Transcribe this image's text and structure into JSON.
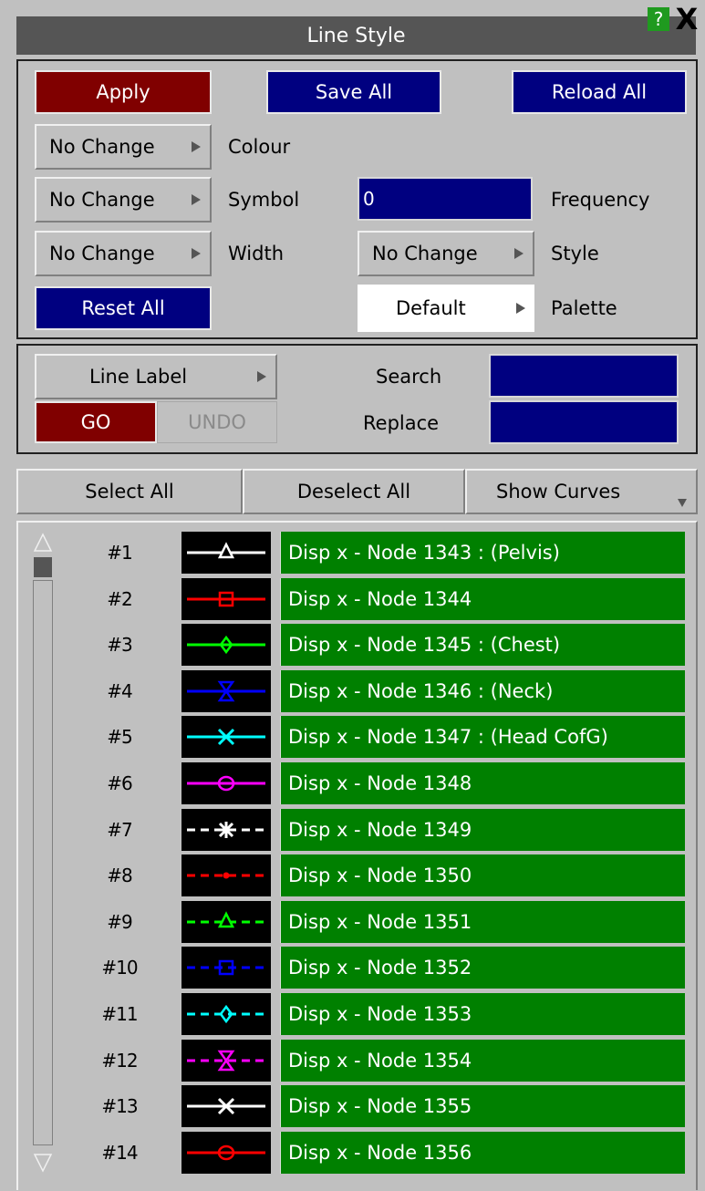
{
  "window": {
    "title": "Line Style",
    "help_label": "?",
    "close_label": "X"
  },
  "toolbar": {
    "apply_label": "Apply",
    "save_all_label": "Save All",
    "reload_all_label": "Reload All",
    "reset_all_label": "Reset All"
  },
  "properties": {
    "colour": {
      "value": "No Change",
      "label": "Colour"
    },
    "symbol": {
      "value": "No Change",
      "label": "Symbol"
    },
    "frequency": {
      "value": "0",
      "label": "Frequency"
    },
    "width": {
      "value": "No Change",
      "label": "Width"
    },
    "style": {
      "value": "No Change",
      "label": "Style"
    },
    "palette": {
      "value": "Default",
      "label": "Palette"
    }
  },
  "label_edit": {
    "mode": "Line Label",
    "go_label": "GO",
    "undo_label": "UNDO",
    "search_label": "Search",
    "search_value": "",
    "replace_label": "Replace",
    "replace_value": ""
  },
  "selection": {
    "select_all_label": "Select All",
    "deselect_all_label": "Deselect All",
    "show_curves_label": "Show Curves"
  },
  "curves": [
    {
      "num": "#1",
      "name": "Disp x - Node 1343 : (Pelvis)",
      "color": "#ffffff",
      "symbol": "triangle",
      "dashed": false
    },
    {
      "num": "#2",
      "name": "Disp x - Node 1344",
      "color": "#ff0000",
      "symbol": "square",
      "dashed": false
    },
    {
      "num": "#3",
      "name": "Disp x - Node 1345 : (Chest)",
      "color": "#00ff00",
      "symbol": "diamond",
      "dashed": false
    },
    {
      "num": "#4",
      "name": "Disp x - Node 1346 : (Neck)",
      "color": "#0000ff",
      "symbol": "hourglass",
      "dashed": false
    },
    {
      "num": "#5",
      "name": "Disp x - Node 1347 : (Head CofG)",
      "color": "#00ffff",
      "symbol": "cross",
      "dashed": false
    },
    {
      "num": "#6",
      "name": "Disp x - Node 1348",
      "color": "#ff00ff",
      "symbol": "circle",
      "dashed": false
    },
    {
      "num": "#7",
      "name": "Disp x - Node 1349",
      "color": "#ffffff",
      "symbol": "star",
      "dashed": true
    },
    {
      "num": "#8",
      "name": "Disp x - Node 1350",
      "color": "#ff0000",
      "symbol": "dot",
      "dashed": true
    },
    {
      "num": "#9",
      "name": "Disp x - Node 1351",
      "color": "#00ff00",
      "symbol": "triangle",
      "dashed": true
    },
    {
      "num": "#10",
      "name": "Disp x - Node 1352",
      "color": "#0000ff",
      "symbol": "square",
      "dashed": true
    },
    {
      "num": "#11",
      "name": "Disp x - Node 1353",
      "color": "#00ffff",
      "symbol": "diamond",
      "dashed": true
    },
    {
      "num": "#12",
      "name": "Disp x - Node 1354",
      "color": "#ff00ff",
      "symbol": "hourglass",
      "dashed": true
    },
    {
      "num": "#13",
      "name": "Disp x - Node 1355",
      "color": "#ffffff",
      "symbol": "cross",
      "dashed": false
    },
    {
      "num": "#14",
      "name": "Disp x - Node 1356",
      "color": "#ff0000",
      "symbol": "circle",
      "dashed": false
    }
  ]
}
